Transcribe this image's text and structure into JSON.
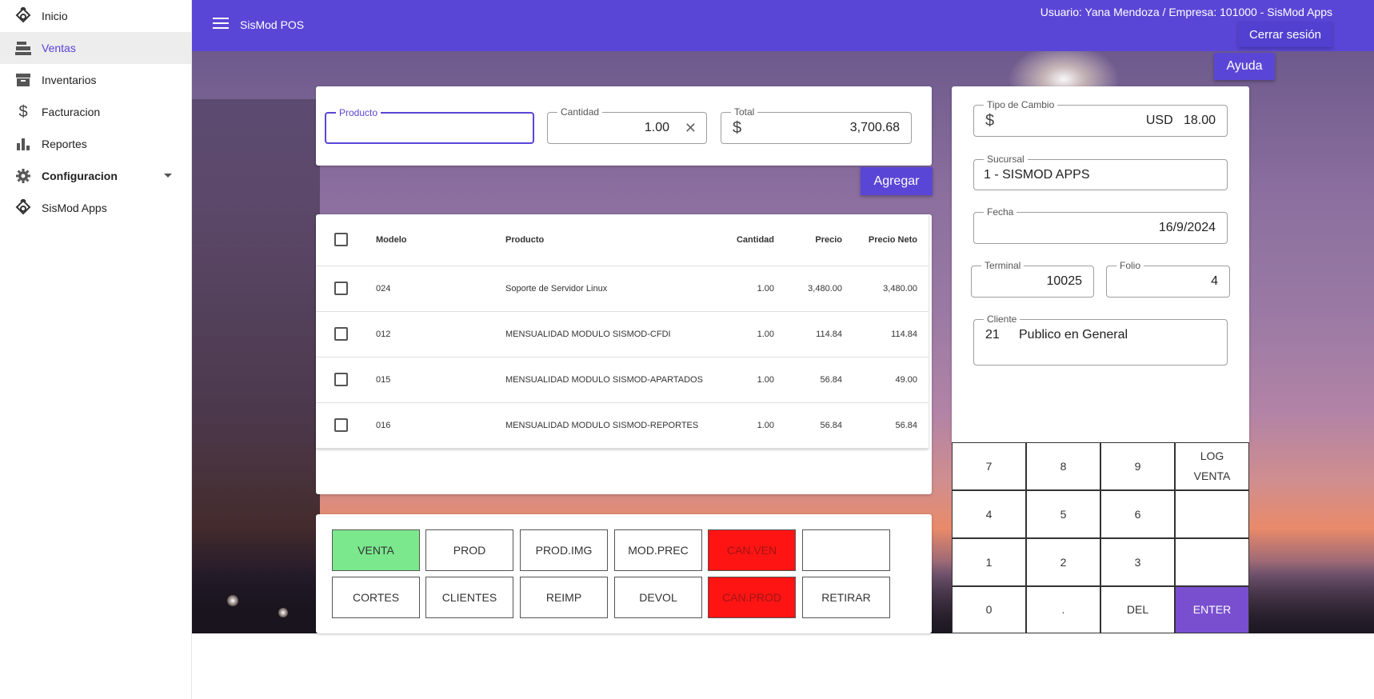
{
  "sidebar": {
    "items": [
      {
        "label": "Inicio",
        "icon": "sismod-logo-icon"
      },
      {
        "label": "Ventas",
        "icon": "cash-register-icon"
      },
      {
        "label": "Inventarios",
        "icon": "archive-icon"
      },
      {
        "label": "Facturacion",
        "icon": "dollar-icon"
      },
      {
        "label": "Reportes",
        "icon": "bar-chart-icon"
      },
      {
        "label": "Configuracion",
        "icon": "gear-icon"
      },
      {
        "label": "SisMod Apps",
        "icon": "sismod-logo-icon"
      }
    ]
  },
  "header": {
    "title": "SisMod POS",
    "user_info": "Usuario: Yana Mendoza / Empresa: 101000 - SisMod Apps",
    "logout_label": "Cerrar sesión",
    "help_label": "Ayuda"
  },
  "entry": {
    "producto_label": "Producto",
    "producto_value": "",
    "cantidad_label": "Cantidad",
    "cantidad_value": "1.00",
    "total_label": "Total",
    "total_prefix": "$",
    "total_value": "3,700.68",
    "add_label": "Agregar"
  },
  "table": {
    "headers": {
      "modelo": "Modelo",
      "producto": "Producto",
      "cantidad": "Cantidad",
      "precio": "Precio",
      "precio_neto": "Precio Neto"
    },
    "rows": [
      {
        "modelo": "024",
        "producto": "Soporte de Servidor Linux",
        "cantidad": "1.00",
        "precio": "3,480.00",
        "precio_neto": "3,480.00"
      },
      {
        "modelo": "012",
        "producto": "MENSUALIDAD MODULO SISMOD-CFDI",
        "cantidad": "1.00",
        "precio": "114.84",
        "precio_neto": "114.84"
      },
      {
        "modelo": "015",
        "producto": "MENSUALIDAD MODULO SISMOD-APARTADOS",
        "cantidad": "1.00",
        "precio": "56.84",
        "precio_neto": "49.00"
      },
      {
        "modelo": "016",
        "producto": "MENSUALIDAD MODULO SISMOD-REPORTES",
        "cantidad": "1.00",
        "precio": "56.84",
        "precio_neto": "56.84"
      }
    ]
  },
  "functions": {
    "row1": [
      "VENTA",
      "PROD",
      "PROD.IMG",
      "MOD.PREC",
      "CAN.VEN",
      ""
    ],
    "row2": [
      "CORTES",
      "CLIENTES",
      "REIMP",
      "DEVOL",
      "CAN.PROD",
      "RETIRAR"
    ]
  },
  "side": {
    "tipo_cambio_label": "Tipo de Cambio",
    "tipo_cambio_prefix": "$",
    "tipo_cambio_value": "USD   18.00",
    "sucursal_label": "Sucursal",
    "sucursal_value": "1 - SISMOD APPS",
    "fecha_label": "Fecha",
    "fecha_value": "16/9/2024",
    "terminal_label": "Terminal",
    "terminal_value": "10025",
    "folio_label": "Folio",
    "folio_value": "4",
    "cliente_label": "Cliente",
    "cliente_id": "21",
    "cliente_name": "Publico en General"
  },
  "keypad": {
    "keys": [
      "7",
      "8",
      "9",
      "LOG\nVENTA",
      "4",
      "5",
      "6",
      "",
      "1",
      "2",
      "3",
      "",
      "0",
      ".",
      "DEL",
      "ENTER"
    ]
  },
  "colors": {
    "primary": "#5a46d6",
    "venta_green": "#7be88d",
    "cancel_red": "#ff1414",
    "enter_purple": "#7a4fcf"
  }
}
